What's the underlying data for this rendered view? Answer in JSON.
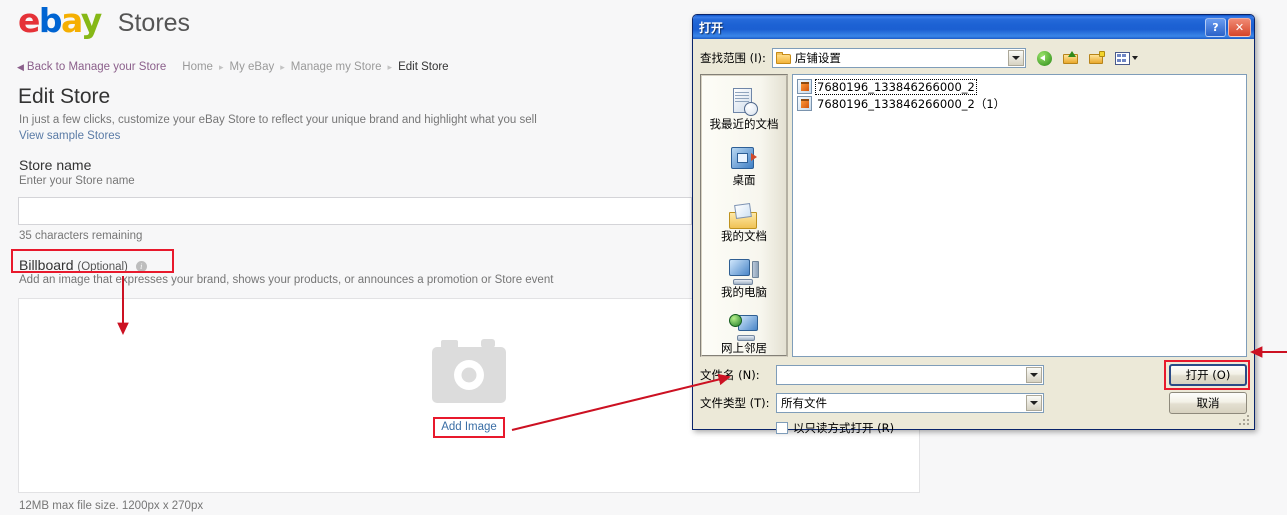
{
  "ebay": {
    "logo": {
      "l1": "e",
      "l2": "b",
      "l3": "a",
      "l4": "y"
    },
    "logo_colors": {
      "e": "#e53238",
      "b": "#0064d2",
      "a": "#f5af02",
      "y": "#86b817"
    },
    "site_section": "Stores",
    "breadcrumb": {
      "back_link": "Back to Manage your Store",
      "items": [
        "Home",
        "My eBay",
        "Manage my Store"
      ],
      "current": "Edit Store",
      "separator": "▸"
    },
    "page_title": "Edit Store",
    "page_subtitle": "In just a few clicks, customize your eBay Store to reflect your unique brand and highlight what you sell",
    "sample_link": "View sample Stores",
    "store_name": {
      "label": "Store name",
      "hint": "Enter your Store name",
      "value": "",
      "placeholder": "",
      "chars_remaining": "35 characters remaining"
    },
    "billboard": {
      "label": "Billboard",
      "optional": "(Optional)",
      "info_icon": "info-icon",
      "hint": "Add an image that expresses your brand, shows your products, or announces a promotion or Store event",
      "add_image_label": "Add Image",
      "camera_icon": "camera-icon",
      "note": "12MB max file size. 1200px x 270px"
    },
    "accent_colors": {
      "link": "#5a7ba6",
      "visited_link": "#8b5f8b",
      "annotation_red": "#e8192c"
    }
  },
  "dialog": {
    "title": "打开",
    "help_button": "?",
    "close_button": "✕",
    "look_in_label": "查找范围 (I):",
    "look_in_value": "店铺设置",
    "toolbar": [
      {
        "name": "back-icon",
        "label": "后退"
      },
      {
        "name": "up-one-level-icon",
        "label": "向上一级"
      },
      {
        "name": "new-folder-icon",
        "label": "新建文件夹"
      },
      {
        "name": "views-icon",
        "label": "查看"
      }
    ],
    "places": [
      {
        "label": "我最近的文档",
        "icon": "recent-documents-icon"
      },
      {
        "label": "桌面",
        "icon": "desktop-icon"
      },
      {
        "label": "我的文档",
        "icon": "my-documents-icon"
      },
      {
        "label": "我的电脑",
        "icon": "my-computer-icon"
      },
      {
        "label": "网上邻居",
        "icon": "my-network-places-icon"
      }
    ],
    "files": [
      {
        "name": "7680196_133846266000_2",
        "selected": true
      },
      {
        "name": "7680196_133846266000_2（1）",
        "selected": false
      }
    ],
    "file_name_label": "文件名 (N):",
    "file_name_value": "",
    "file_type_label": "文件类型 (T):",
    "file_type_value": "所有文件",
    "readonly_label": "以只读方式打开 (R)",
    "readonly_checked": false,
    "open_button": "打开 (O)",
    "cancel_button": "取消"
  }
}
